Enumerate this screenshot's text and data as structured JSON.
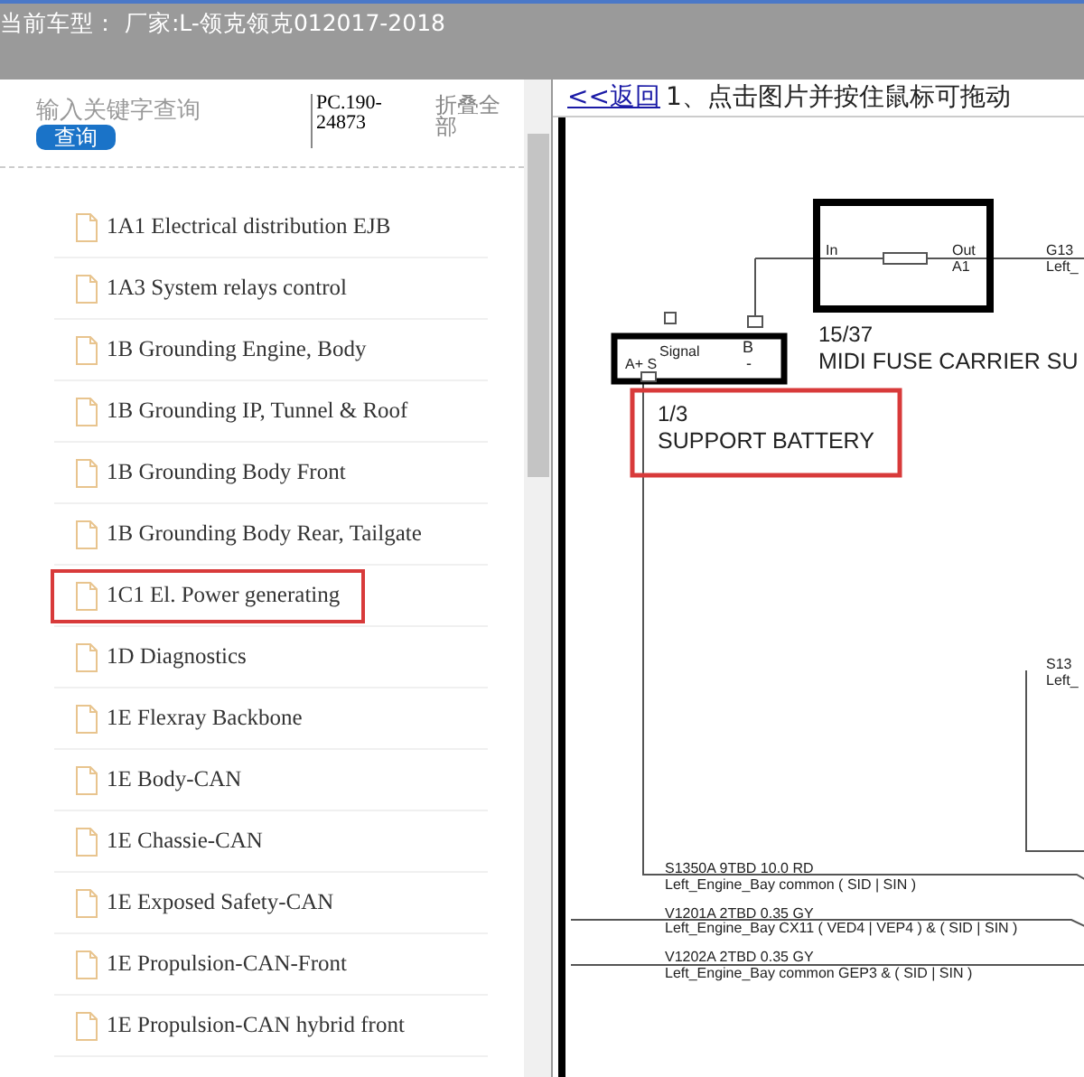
{
  "header": {
    "title": "当前车型： 厂家:L-领克领克012017-2018"
  },
  "search": {
    "placeholder": "输入关键字查询",
    "button": "查询",
    "code": "PC.190-24873",
    "collapse": "折叠全部"
  },
  "items": [
    {
      "label": "1A1 Electrical distribution EJB",
      "highlighted": false
    },
    {
      "label": "1A3 System relays control",
      "highlighted": false
    },
    {
      "label": "1B Grounding Engine, Body",
      "highlighted": false
    },
    {
      "label": "1B Grounding IP, Tunnel & Roof",
      "highlighted": false
    },
    {
      "label": "1B Grounding Body Front",
      "highlighted": false
    },
    {
      "label": "1B Grounding Body Rear, Tailgate",
      "highlighted": false
    },
    {
      "label": "1C1 El. Power generating",
      "highlighted": true
    },
    {
      "label": "1D Diagnostics",
      "highlighted": false
    },
    {
      "label": "1E Flexray Backbone",
      "highlighted": false
    },
    {
      "label": "1E Body-CAN",
      "highlighted": false
    },
    {
      "label": "1E Chassie-CAN",
      "highlighted": false
    },
    {
      "label": "1E Exposed Safety-CAN",
      "highlighted": false
    },
    {
      "label": "1E Propulsion-CAN-Front",
      "highlighted": false
    },
    {
      "label": "1E Propulsion-CAN hybrid front",
      "highlighted": false
    }
  ],
  "viewer": {
    "back_link": "<<返回",
    "hint": "1、点击图片并按住鼠标可拖动",
    "labels": [
      "In",
      "Out",
      "G13",
      "A1",
      "Left_",
      "Signal",
      "B",
      "15/37",
      "A+ S",
      "-",
      "MIDI FUSE CARRIER SU",
      "1/3",
      "SUPPORT BATTERY",
      "S13",
      "Left_",
      "S1350A  9TBD 10.0 RD",
      "Left_Engine_Bay  common   ( SID | SIN )",
      "V1201A  2TBD 0.35 GY",
      "Left_Engine_Bay  CX11   ( VED4 | VEP4 ) & ( SID | SIN )",
      "V1202A  2TBD 0.35 GY",
      "Left_Engine_Bay  common   GEP3 & ( SID | SIN )"
    ]
  }
}
